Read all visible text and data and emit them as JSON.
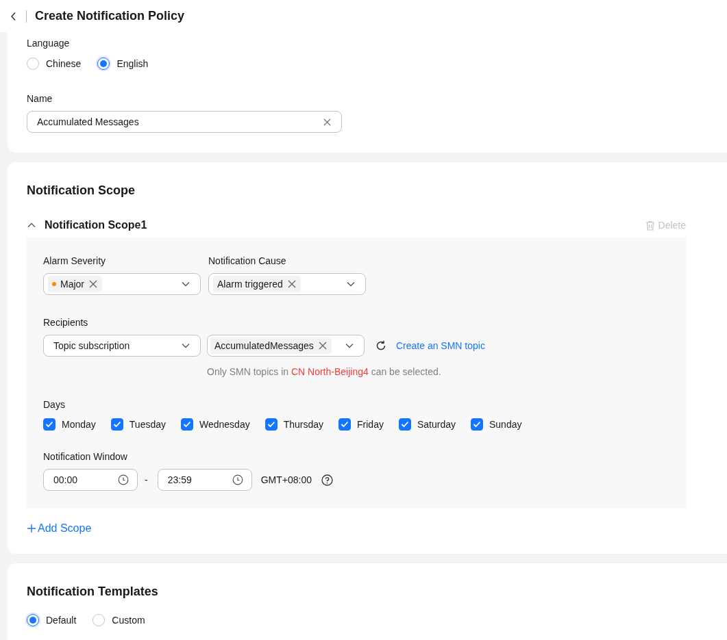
{
  "header": {
    "title": "Create Notification Policy"
  },
  "basic": {
    "language": {
      "label": "Language",
      "options": [
        {
          "label": "Chinese",
          "selected": false
        },
        {
          "label": "English",
          "selected": true
        }
      ]
    },
    "name": {
      "label": "Name",
      "value": "Accumulated Messages"
    }
  },
  "scope_section": {
    "title": "Notification Scope",
    "scopes": [
      {
        "title": "Notification Scope1",
        "expanded": true,
        "delete_label": "Delete",
        "alarm_severity": {
          "label": "Alarm Severity",
          "tags": [
            {
              "label": "Major",
              "color": "#ff8a00"
            }
          ]
        },
        "cause": {
          "label": "Notification Cause",
          "tags": [
            {
              "label": "Alarm triggered"
            }
          ]
        },
        "recipients": {
          "label": "Recipients",
          "type_value": "Topic subscription",
          "topics": [
            {
              "label": "AccumulatedMessages"
            }
          ],
          "create_link": "Create an SMN topic",
          "hint": [
            {
              "text": "Only SMN topics in ",
              "highlight": false
            },
            {
              "text": "CN North-Beijing4",
              "highlight": true
            },
            {
              "text": " can be selected.",
              "highlight": false
            }
          ]
        },
        "days": {
          "label": "Days",
          "items": [
            {
              "label": "Monday",
              "checked": true
            },
            {
              "label": "Tuesday",
              "checked": true
            },
            {
              "label": "Wednesday",
              "checked": true
            },
            {
              "label": "Thursday",
              "checked": true
            },
            {
              "label": "Friday",
              "checked": true
            },
            {
              "label": "Saturday",
              "checked": true
            },
            {
              "label": "Sunday",
              "checked": true
            }
          ]
        },
        "window": {
          "label": "Notification Window",
          "start": "00:00",
          "separator": "-",
          "end": "23:59",
          "timezone": "GMT+08:00"
        }
      }
    ],
    "add_scope": "Add Scope"
  },
  "templates": {
    "title": "Notification Templates",
    "options": [
      {
        "label": "Default",
        "selected": true
      },
      {
        "label": "Custom",
        "selected": false
      }
    ]
  }
}
